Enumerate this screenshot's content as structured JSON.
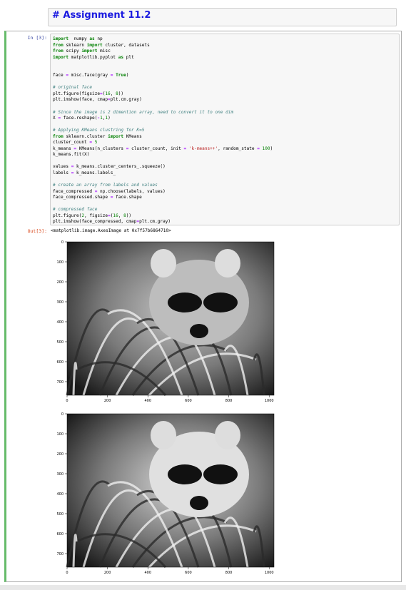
{
  "markdown": {
    "title": "# Assignment 11.2"
  },
  "cell": {
    "in_prompt": "In [3]:",
    "out_prompt": "Out[3]:",
    "output_text": "<matplotlib.image.AxesImage at 0x7f57b6864710>",
    "code_lines": [
      [
        [
          "kw",
          "import"
        ],
        [
          "",
          "  numpy "
        ],
        [
          "kw",
          "as"
        ],
        [
          "",
          " np"
        ]
      ],
      [
        [
          "kw",
          "from"
        ],
        [
          "",
          " sklearn "
        ],
        [
          "kw",
          "import"
        ],
        [
          "",
          " cluster, datasets"
        ]
      ],
      [
        [
          "kw",
          "from"
        ],
        [
          "",
          " scipy "
        ],
        [
          "kw",
          "import"
        ],
        [
          "",
          " misc"
        ]
      ],
      [
        [
          "kw",
          "import"
        ],
        [
          "",
          " matplotlib.pyplot "
        ],
        [
          "kw",
          "as"
        ],
        [
          "",
          " plt"
        ]
      ],
      [],
      [],
      [
        [
          "",
          " face "
        ],
        [
          "op",
          "="
        ],
        [
          "",
          " misc.face(gray "
        ],
        [
          "op",
          "="
        ],
        [
          "",
          " "
        ],
        [
          "kw",
          "True"
        ],
        [
          "",
          ")"
        ]
      ],
      [],
      [
        [
          "cmt",
          "# original face"
        ]
      ],
      [
        [
          "",
          "plt.figure(figsize"
        ],
        [
          "op",
          "="
        ],
        [
          "",
          "("
        ],
        [
          "num",
          "16"
        ],
        [
          "",
          ", "
        ],
        [
          "num",
          "8"
        ],
        [
          "",
          "))"
        ]
      ],
      [
        [
          "",
          "plt.imshow(face, cmap"
        ],
        [
          "op",
          "="
        ],
        [
          "",
          "plt.cm.gray)"
        ]
      ],
      [],
      [
        [
          "cmt",
          "# Since the image is 2 dimention array, need to convert it to one dim"
        ]
      ],
      [
        [
          "",
          "X "
        ],
        [
          "op",
          "="
        ],
        [
          "",
          " face.reshape("
        ],
        [
          "op",
          "-"
        ],
        [
          "num",
          "1"
        ],
        [
          "",
          ","
        ],
        [
          "num",
          "1"
        ],
        [
          "",
          ")"
        ]
      ],
      [],
      [
        [
          "cmt",
          "# Applying KMeans clustring for K=5"
        ]
      ],
      [
        [
          "kw",
          "from"
        ],
        [
          "",
          " sklearn.cluster "
        ],
        [
          "kw",
          "import"
        ],
        [
          "",
          " KMeans"
        ]
      ],
      [
        [
          "",
          "cluster_count "
        ],
        [
          "op",
          "="
        ],
        [
          "",
          " "
        ],
        [
          "num",
          "5"
        ]
      ],
      [
        [
          "",
          "k_means "
        ],
        [
          "op",
          "="
        ],
        [
          "",
          " KMeans(n_clusters "
        ],
        [
          "op",
          "="
        ],
        [
          "",
          " cluster_count, init "
        ],
        [
          "op",
          "="
        ],
        [
          "",
          " "
        ],
        [
          "str",
          "'k-means++'"
        ],
        [
          "",
          ", random_state "
        ],
        [
          "op",
          "="
        ],
        [
          "",
          " "
        ],
        [
          "num",
          "100"
        ],
        [
          "",
          ")"
        ]
      ],
      [
        [
          "",
          "k_means.fit(X)"
        ]
      ],
      [],
      [
        [
          "",
          "values "
        ],
        [
          "op",
          "="
        ],
        [
          "",
          " k_means.cluster_centers_.squeeze()"
        ]
      ],
      [
        [
          "",
          "labels "
        ],
        [
          "op",
          "="
        ],
        [
          "",
          " k_means.labels_"
        ]
      ],
      [],
      [
        [
          "cmt",
          "# create an array from labels and values"
        ]
      ],
      [
        [
          "",
          "face_compressed "
        ],
        [
          "op",
          "="
        ],
        [
          "",
          " np.choose(labels, values)"
        ]
      ],
      [
        [
          "",
          "face_compressed.shape "
        ],
        [
          "op",
          "="
        ],
        [
          "",
          " face.shape"
        ]
      ],
      [],
      [
        [
          "cmt",
          "# compressed face"
        ]
      ],
      [
        [
          "",
          "plt.figure("
        ],
        [
          "num",
          "2"
        ],
        [
          "",
          ", figsize"
        ],
        [
          "op",
          "="
        ],
        [
          "",
          "("
        ],
        [
          "num",
          "16"
        ],
        [
          "",
          ", "
        ],
        [
          "num",
          "8"
        ],
        [
          "",
          "))"
        ]
      ],
      [
        [
          "",
          "plt.imshow(face_compressed, cmap"
        ],
        [
          "op",
          "="
        ],
        [
          "",
          "plt.cm.gray)"
        ]
      ]
    ]
  },
  "plots": [
    {
      "name": "original-face-plot",
      "image_alt": "grayscale raccoon face",
      "yticks": [
        "0",
        "100",
        "200",
        "300",
        "400",
        "500",
        "600",
        "700"
      ],
      "xticks": [
        "0",
        "200",
        "400",
        "600",
        "800",
        "1000"
      ]
    },
    {
      "name": "compressed-face-plot",
      "image_alt": "k-means compressed raccoon face",
      "yticks": [
        "0",
        "100",
        "200",
        "300",
        "400",
        "500",
        "600",
        "700"
      ],
      "xticks": [
        "0",
        "200",
        "400",
        "600",
        "800",
        "1000"
      ]
    }
  ]
}
